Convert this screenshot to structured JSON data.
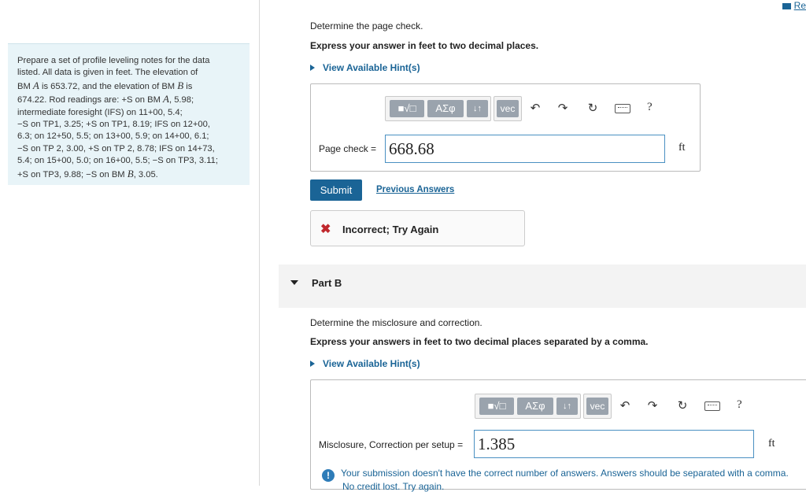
{
  "problem": {
    "lines": [
      "Prepare a set of profile leveling notes for the data",
      "listed. All data is given in feet. The elevation of",
      [
        "BM ",
        "A",
        " is 653.72, and the elevation of BM ",
        "B",
        " is"
      ],
      [
        "674.22. Rod readings are: +S on BM ",
        "A",
        ", 5.98;"
      ],
      "intermediate foresight (IFS) on 11+00, 5.4;",
      "−S on TP1, 3.25; +S on TP1, 8.19; IFS on 12+00,",
      "6.3; on 12+50, 5.5; on 13+00, 5.9; on 14+00, 6.1;",
      "−S on TP 2, 3.00, +S on TP 2, 8.78; IFS on 14+73,",
      "5.4; on 15+00, 5.0; on 16+00, 5.5; −S on TP3, 3.11;",
      [
        "+S on TP3, 9.88; −S on BM ",
        "B",
        ", 3.05."
      ]
    ]
  },
  "header": {
    "review_label": "Re"
  },
  "part_a": {
    "instruction": "Determine the page check.",
    "format_note": "Express your answer in feet to two decimal places.",
    "hints_label": "View Available Hint(s)",
    "field_label": "Page check =",
    "field_value": "668.68",
    "unit": "ft",
    "submit_label": "Submit",
    "previous_answers_label": "Previous Answers",
    "feedback_mark": "✖",
    "feedback_text": "Incorrect; Try Again"
  },
  "toolbar": {
    "templates_label": "■√□",
    "greek_label": "ΑΣφ",
    "arrows_label": "↓↑",
    "vec_label": "vec",
    "undo_icon": "↶",
    "redo_icon": "↷",
    "reset_icon": "↻",
    "help_label": "?"
  },
  "part_b": {
    "title": "Part B",
    "instruction": "Determine the misclosure and correction.",
    "format_note": "Express your answers in feet to two decimal places separated by a comma.",
    "hints_label": "View Available Hint(s)",
    "field_label": "Misclosure, Correction per setup =",
    "field_value": "1.385",
    "unit": "ft",
    "warning_mark": "!",
    "warning_text": "Your submission doesn't have the correct number of answers. Answers should be separated with a comma.",
    "warning_text2": "No credit lost. Try again."
  }
}
